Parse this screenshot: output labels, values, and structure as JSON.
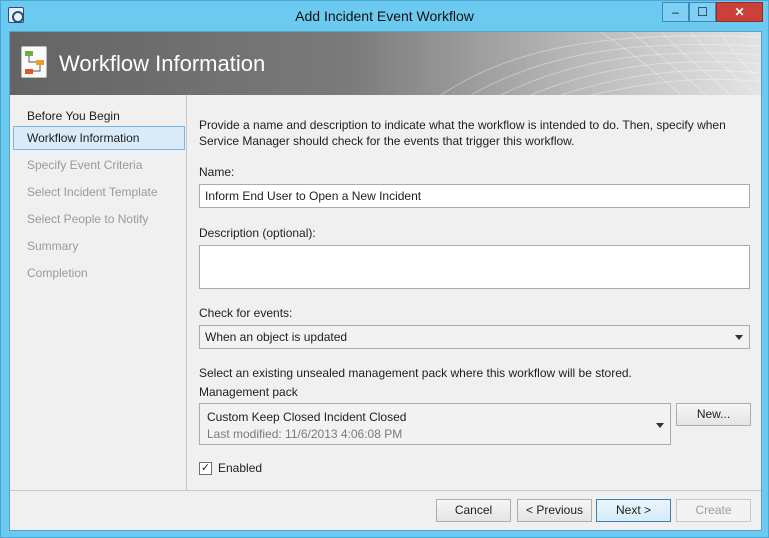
{
  "window": {
    "title": "Add Incident Event Workflow",
    "minimize_glyph": "‒",
    "maximize_glyph": "☐",
    "close_glyph": "✕"
  },
  "header": {
    "title": "Workflow Information"
  },
  "sidebar": {
    "items": [
      {
        "label": "Before You Begin",
        "state": "done"
      },
      {
        "label": "Workflow Information",
        "state": "active"
      },
      {
        "label": "Specify Event Criteria",
        "state": "pending"
      },
      {
        "label": "Select Incident Template",
        "state": "pending"
      },
      {
        "label": "Select People to Notify",
        "state": "pending"
      },
      {
        "label": "Summary",
        "state": "pending"
      },
      {
        "label": "Completion",
        "state": "pending"
      }
    ]
  },
  "main": {
    "intro": "Provide a name and description to indicate what the workflow is intended to do. Then, specify when Service Manager should check for the events that trigger this workflow.",
    "name_label": "Name:",
    "name_value": "Inform End User to Open a New Incident",
    "description_label": "Description (optional):",
    "description_value": "",
    "check_events_label": "Check for events:",
    "check_events_value": "When an object is updated",
    "mp_instruction": "Select an existing unsealed management pack where this workflow will be stored.",
    "mp_label": "Management pack",
    "mp_name": "Custom Keep Closed Incident Closed",
    "mp_modified": "Last modified:  11/6/2013 4:06:08 PM",
    "new_button": "New...",
    "enabled_label": "Enabled",
    "enabled_checked": true,
    "check_glyph": "✓"
  },
  "footer": {
    "cancel": "Cancel",
    "previous": "< Previous",
    "next": "Next >",
    "create": "Create"
  },
  "colors": {
    "titlebar": "#6ccaf0",
    "header_dark": "#646464",
    "active_nav": "#d9ebf9",
    "close_button": "#c9413a"
  },
  "icons": [
    "app-icon",
    "workflow-icon",
    "dropdown-arrow-icon",
    "checkbox-check-icon"
  ]
}
